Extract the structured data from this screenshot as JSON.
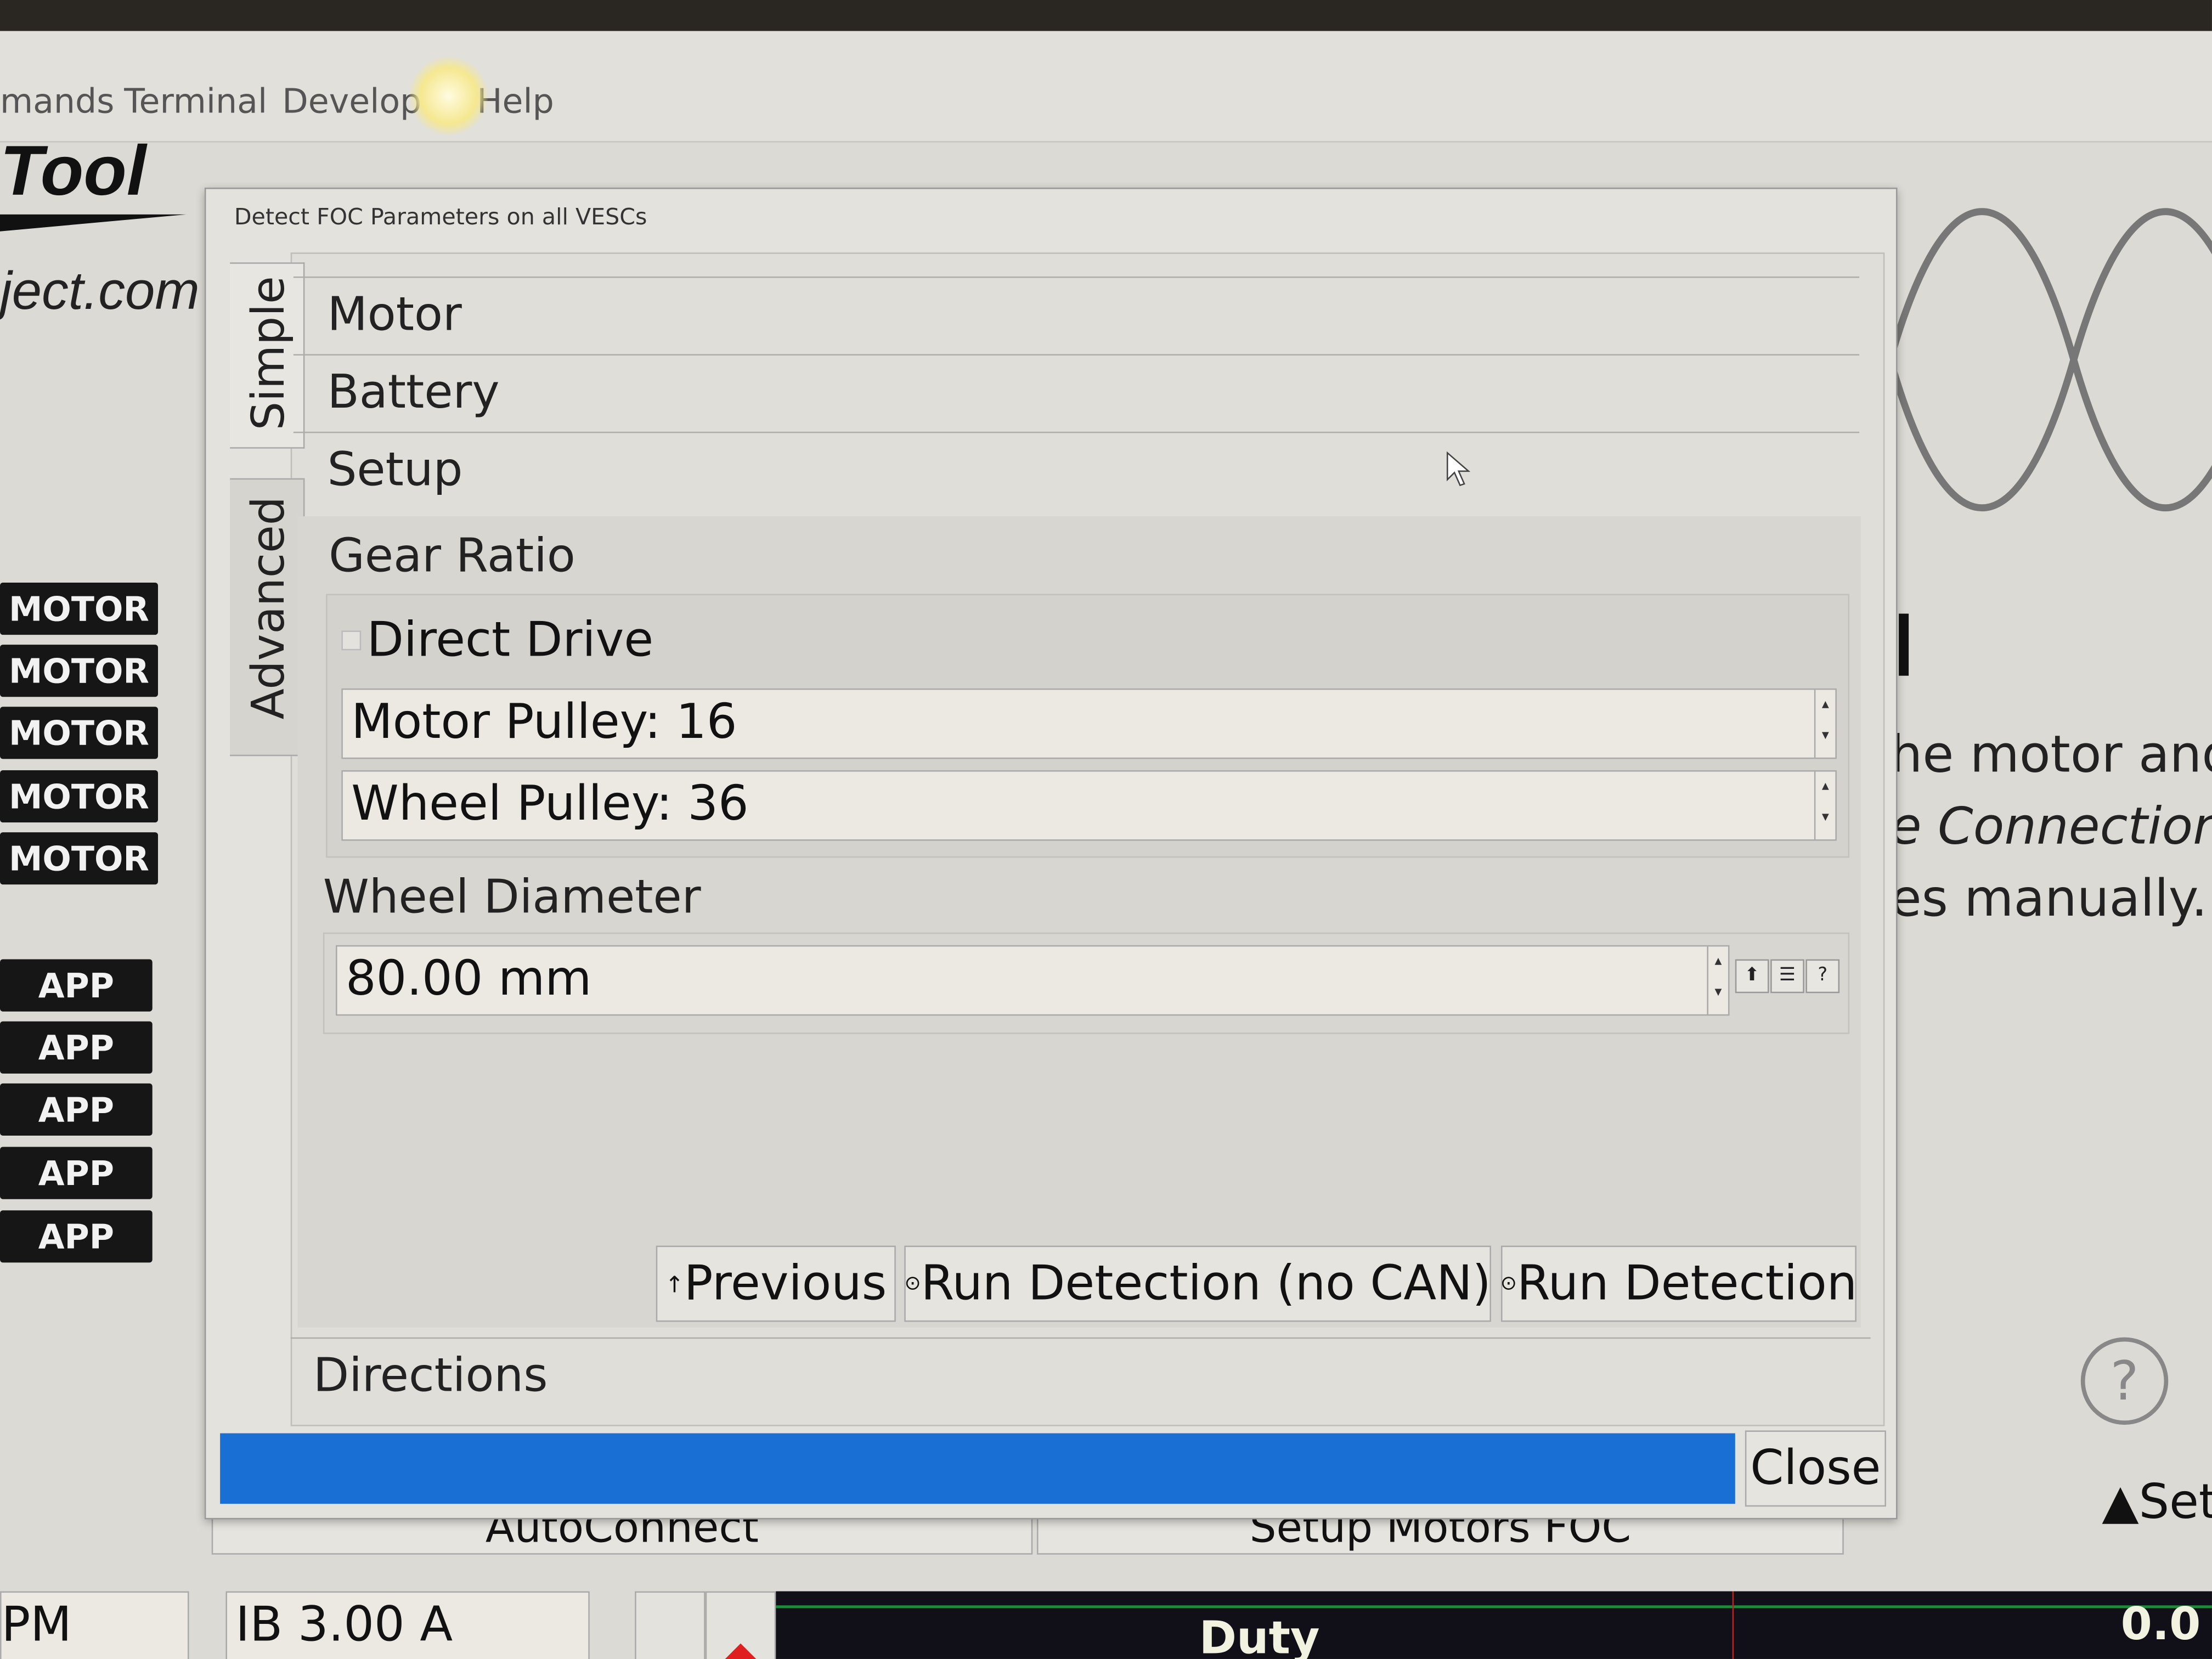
{
  "menu": {
    "items": [
      "mands",
      "Terminal",
      "Develop",
      "Help"
    ]
  },
  "logo": {
    "text": "Tool",
    "url": "ject.com"
  },
  "sidebar": {
    "motor_buttons": [
      "MOTOR",
      "MOTOR",
      "MOTOR",
      "MOTOR",
      "MOTOR"
    ],
    "app_buttons": [
      "APP",
      "APP",
      "APP",
      "APP",
      "APP"
    ]
  },
  "dialog": {
    "title": "Detect FOC Parameters on all VESCs",
    "tabs": {
      "simple": "Simple",
      "advanced": "Advanced"
    },
    "sections": {
      "motor": "Motor",
      "battery": "Battery",
      "setup": "Setup",
      "directions": "Directions"
    },
    "gear_ratio": {
      "heading": "Gear Ratio",
      "direct_drive_label": "Direct Drive",
      "direct_drive_checked": false,
      "motor_pulley": "Motor Pulley: 16",
      "wheel_pulley": "Wheel Pulley: 36"
    },
    "wheel_diameter": {
      "heading": "Wheel Diameter",
      "value": "80.00 mm",
      "icons": [
        "upload-icon",
        "database-icon",
        "help-icon"
      ]
    },
    "buttons": {
      "previous": "Previous",
      "run_no_can": "Run Detection (no CAN)",
      "run": "Run Detection"
    },
    "progress_color": "#1a6fd4",
    "progress_percent": 100,
    "close": "Close"
  },
  "background": {
    "lines": [
      "he motor and",
      "e Connection",
      "es manually."
    ],
    "autoconnect": "AutoConnect",
    "setup_motors": "Setup Motors FOC",
    "set_button": "Set"
  },
  "bottom": {
    "rpm_field": "PM",
    "ib_field": "IB 3.00 A",
    "duty_label": "Duty",
    "duty_value": "0.0"
  }
}
